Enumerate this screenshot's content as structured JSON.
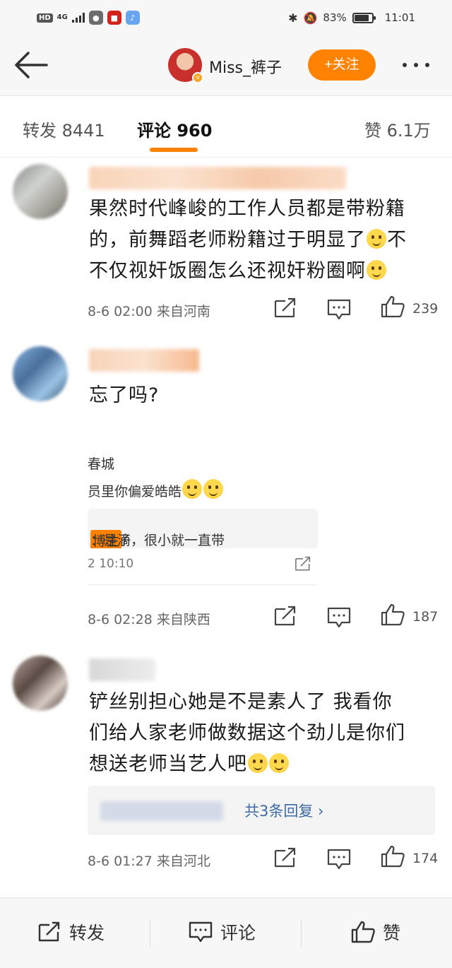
{
  "status_bar": {
    "hd": "HD",
    "network": "4G",
    "battery": "83%",
    "battery_level": 0.83,
    "time": "11:01"
  },
  "nav": {
    "nickname": "Miss_裤子",
    "follow_label": "+关注"
  },
  "tabs": {
    "repost": "转发 8441",
    "comments": "评论 960",
    "likes": "赞 6.1万"
  },
  "comments": [
    {
      "lines": [
        "果然时代峰峻的工作人员都是带粉籍",
        "的，前舞蹈老师粉籍过于明显了",
        "不仅视奸饭圈怎么还视奸粉圈啊"
      ],
      "meta": "8-6 02:00 来自河南",
      "likes": "239"
    },
    {
      "lines": [
        "忘了吗?"
      ],
      "quoted": {
        "author": "春城",
        "text": "员里你偏爱皓皓",
        "reply_name": "s_裤子",
        "reply_tag": "博主",
        "reply_text": "：是滴，很小就一直带",
        "time": "2 10:10"
      },
      "meta": "8-6 02:28 来自陕西",
      "likes": "187"
    },
    {
      "lines": [
        "铲丝别担心她是不是素人了 我看你",
        "们给人家老师做数据这个劲儿是你们",
        "想送老师当艺人吧"
      ],
      "replies_link": "共3条回复 ›",
      "meta": "8-6 01:27 来自河北",
      "likes": "174"
    }
  ],
  "bottom_bar": {
    "repost": "转发",
    "comment": "评论",
    "like": "赞"
  },
  "colors": {
    "accent": "#ff8200",
    "link": "#3d6aa6"
  }
}
